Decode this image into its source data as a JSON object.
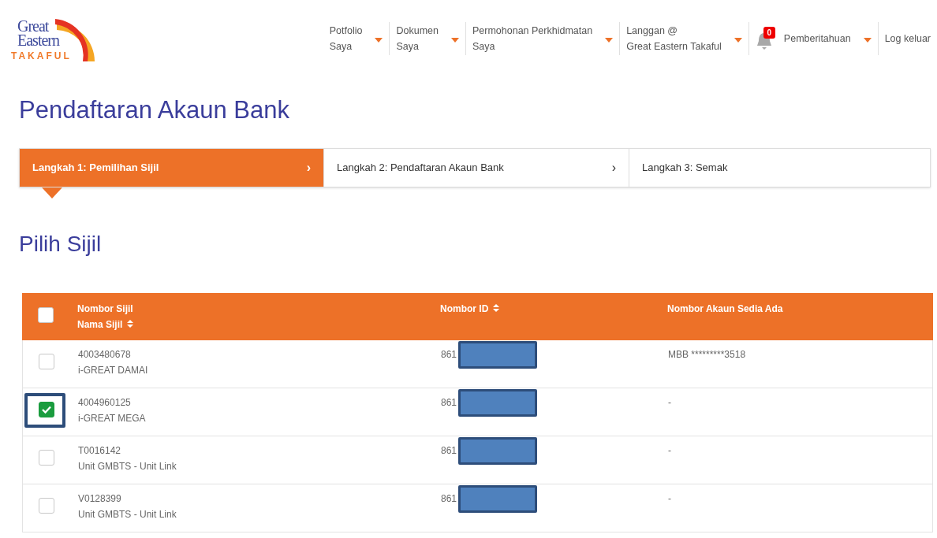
{
  "logo": {
    "line_1": "Great",
    "line_2": "Eastern",
    "line_3": "TAKAFUL"
  },
  "nav": [
    {
      "lines": [
        "Potfolio",
        "Saya"
      ],
      "dropdown": true
    },
    {
      "lines": [
        "Dokumen",
        "Saya"
      ],
      "dropdown": true
    },
    {
      "lines": [
        "Permohonan Perkhidmatan",
        "Saya"
      ],
      "dropdown": true
    },
    {
      "lines": [
        "Langgan @",
        "Great Eastern Takaful"
      ],
      "dropdown": true
    },
    {
      "lines": [
        "Pemberitahuan"
      ],
      "dropdown": true,
      "badge": "0"
    },
    {
      "lines": [
        "Log keluar"
      ],
      "dropdown": false
    }
  ],
  "page_title": "Pendaftaran Akaun Bank",
  "steps": [
    {
      "label": "Langkah 1: Pemilihan Sijil",
      "chevron": "›",
      "selected": true
    },
    {
      "label": "Langkah 2: Pendaftaran Akaun Bank",
      "chevron": "›",
      "selected": false
    },
    {
      "label": "Langkah 3: Semak",
      "selected": false
    }
  ],
  "section_title": "Pilih Sijil",
  "table": {
    "select_all_checked": false,
    "columns": [
      {
        "lines": [
          "Nombor Sijil",
          "Nama Sijil"
        ],
        "sortable": true
      },
      {
        "lines": [
          "Nombor ID"
        ],
        "sortable": true
      },
      {
        "lines": [
          "Nombor Akaun Sedia Ada"
        ],
        "sortable": false
      }
    ],
    "rows": [
      {
        "checked": false,
        "highlighted": false,
        "number": "4003480678",
        "name": "i-GREAT DAMAI",
        "id": "861",
        "id_redacted": true,
        "account": "MBB *********3518"
      },
      {
        "checked": true,
        "highlighted": true,
        "number": "4004960125",
        "name": "i-GREAT MEGA",
        "id": "861",
        "id_redacted": true,
        "account": "-"
      },
      {
        "checked": false,
        "highlighted": false,
        "number": "T0016142",
        "name": "Unit GMBTS - Unit Link",
        "id": "861",
        "id_redacted": true,
        "account": "-"
      },
      {
        "checked": false,
        "highlighted": false,
        "number": "V0128399",
        "name": "Unit GMBTS - Unit Link",
        "id": "861",
        "id_redacted": true,
        "account": "-"
      }
    ]
  }
}
